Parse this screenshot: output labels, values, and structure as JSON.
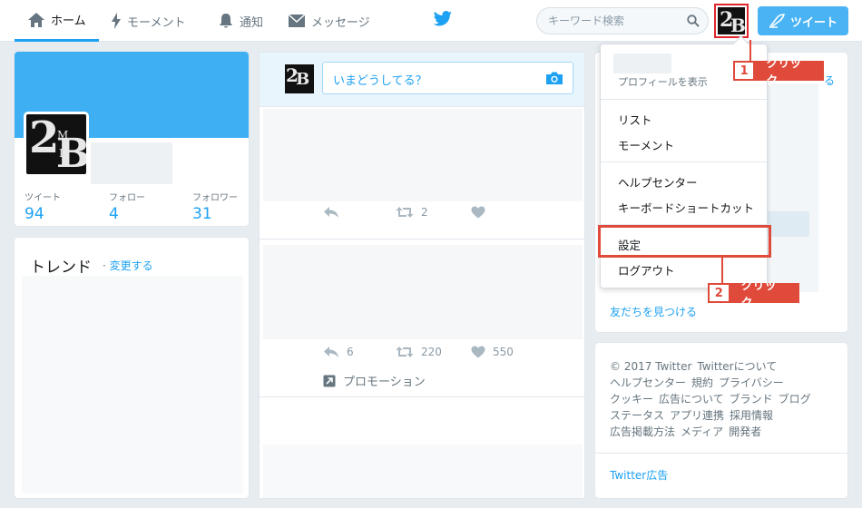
{
  "nav": {
    "home": "ホーム",
    "moments": "モーメント",
    "notifications": "通知",
    "messages": "メッセージ",
    "search_placeholder": "キーワード検索",
    "tweet_button": "ツイート"
  },
  "logo": {
    "big_2": "2",
    "small_m": "M",
    "small_d": "D",
    "big_b": "B"
  },
  "profile": {
    "stats": [
      {
        "label": "ツイート",
        "value": "94"
      },
      {
        "label": "フォロー",
        "value": "4"
      },
      {
        "label": "フォロワー",
        "value": "31"
      }
    ]
  },
  "trends": {
    "title": "トレンド",
    "separator": "·",
    "change_link": "変更する"
  },
  "compose": {
    "placeholder": "いまどうしてる？"
  },
  "tweets": [
    {
      "retweets": "2",
      "likes": ""
    },
    {
      "replies": "6",
      "retweets": "220",
      "likes": "550",
      "promotion": "プロモーション"
    }
  ],
  "right": {
    "suffix": "る",
    "find_friends": "友だちを見つける",
    "footer_links": [
      "© 2017 Twitter",
      "Twitterについて",
      "ヘルプセンター",
      "規約",
      "プライバシー",
      "クッキー",
      "広告について",
      "ブランド",
      "ブログ",
      "ステータス",
      "アプリ連携",
      "採用情報",
      "広告掲載方法",
      "メディア",
      "開発者"
    ],
    "footer_ad": "Twitter広告"
  },
  "dropdown": {
    "view_profile": "プロフィールを表示",
    "lists": "リスト",
    "moments": "モーメント",
    "help_center": "ヘルプセンター",
    "keyboard_shortcuts": "キーボードショートカット",
    "settings": "設定",
    "logout": "ログアウト"
  },
  "callouts": [
    {
      "number": "1",
      "text": "クリック"
    },
    {
      "number": "2",
      "text": "クリック"
    }
  ],
  "colors": {
    "accent": "#1da1f2",
    "callout": "#e04a3a",
    "background": "#e6ecf0"
  }
}
